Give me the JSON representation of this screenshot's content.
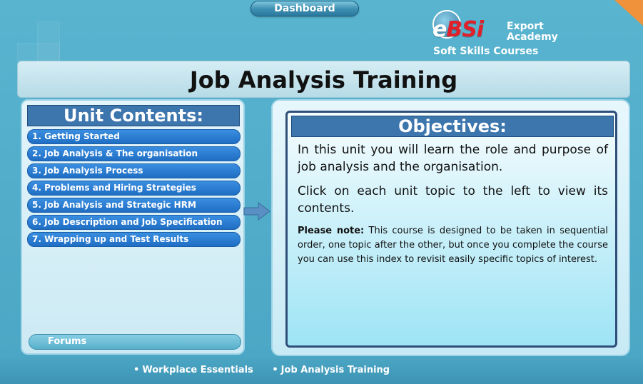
{
  "header": {
    "dashboard_label": "Dashboard",
    "logo": {
      "mark": "eBSi",
      "name_line1": "Export",
      "name_line2": "Academy",
      "subtitle": "Soft Skills Courses"
    }
  },
  "title": "Job Analysis Training",
  "unit_contents": {
    "heading": "Unit Contents:",
    "items": [
      {
        "label": "1. Getting Started"
      },
      {
        "label": "2. Job Analysis & The organisation"
      },
      {
        "label": "3. Job Analysis Process"
      },
      {
        "label": "4. Problems and Hiring Strategies"
      },
      {
        "label": "5. Job Analysis and Strategic HRM"
      },
      {
        "label": "6. Job Description and Job Specification"
      },
      {
        "label": "7. Wrapping up and Test Results"
      }
    ],
    "forums_label": "Forums"
  },
  "objectives": {
    "heading": "Objectives:",
    "paragraph1": "In this unit you will learn the role and purpose of job analysis and the organisation.",
    "paragraph2": "Click on each unit topic to the left to view its contents.",
    "note_label": "Please note:",
    "note_text": " This course is designed to be taken in sequential order, one topic after the other, but once you complete the course you can use this index to revisit easily specific topics of interest."
  },
  "footer": {
    "breadcrumbs": [
      {
        "bullet": "•",
        "label": "Workplace Essentials"
      },
      {
        "bullet": "•",
        "label": "Job Analysis Training"
      }
    ]
  },
  "colors": {
    "background": "#4aa6c4",
    "panel_header": "#3d75ad",
    "unit_button": "#1f6ec4",
    "corner_accent": "#f0923c"
  },
  "icons": {
    "arrow": "arrow-right-icon",
    "logo_globe": "globe-icon"
  }
}
